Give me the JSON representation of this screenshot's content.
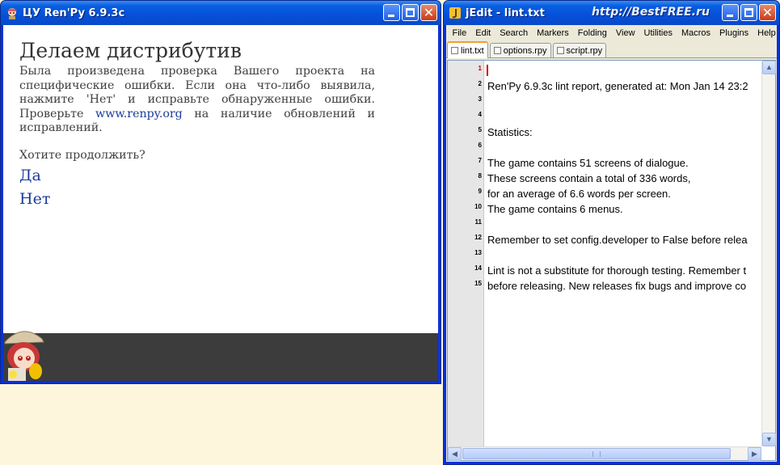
{
  "renpy_window": {
    "title": "ЦУ Ren'Py 6.9.3c",
    "heading": "Делаем дистрибутив",
    "body_part1": "Была произведена проверка Вашего проекта на специфические ошибки. Если она что-либо выявила, нажмите 'Нет' и исправьте обнаруженные ошибки. Проверьте ",
    "link": "www.renpy.org",
    "body_part2": " на наличие обновлений и исправлений.",
    "question": "Хотите продолжить?",
    "choice_yes": "Да",
    "choice_no": "Нет"
  },
  "jedit_window": {
    "title": "jEdit - lint.txt",
    "watermark": "http://BestFREE.ru",
    "menu": [
      "File",
      "Edit",
      "Search",
      "Markers",
      "Folding",
      "View",
      "Utilities",
      "Macros",
      "Plugins",
      "Help"
    ],
    "tabs": [
      "lint.txt",
      "options.rpy",
      "script.rpy"
    ],
    "active_tab": "lint.txt",
    "line_numbers": [
      "1",
      "2",
      "3",
      "4",
      "5",
      "6",
      "7",
      "8",
      "9",
      "10",
      "11",
      "12",
      "13",
      "14",
      "15"
    ],
    "lines": [
      "",
      "Ren'Py 6.9.3c lint report, generated at: Mon Jan 14 23:2",
      "",
      "",
      "Statistics:",
      "",
      "The game contains 51 screens of dialogue.",
      "These screens contain a total of 336 words,",
      "for an average of 6.6 words per screen.",
      "The game contains 6 menus.",
      "",
      "Remember to set config.developer to False before relea",
      "",
      "Lint is not a substitute for thorough testing. Remember t",
      "before releasing. New releases fix bugs and improve co"
    ]
  },
  "colors": {
    "titlebar_blue": "#0450d8",
    "link_blue": "#1a3b9a",
    "desktop_background": "#fdf6dc",
    "renpy_bottom_bar": "#3c3c3c"
  }
}
